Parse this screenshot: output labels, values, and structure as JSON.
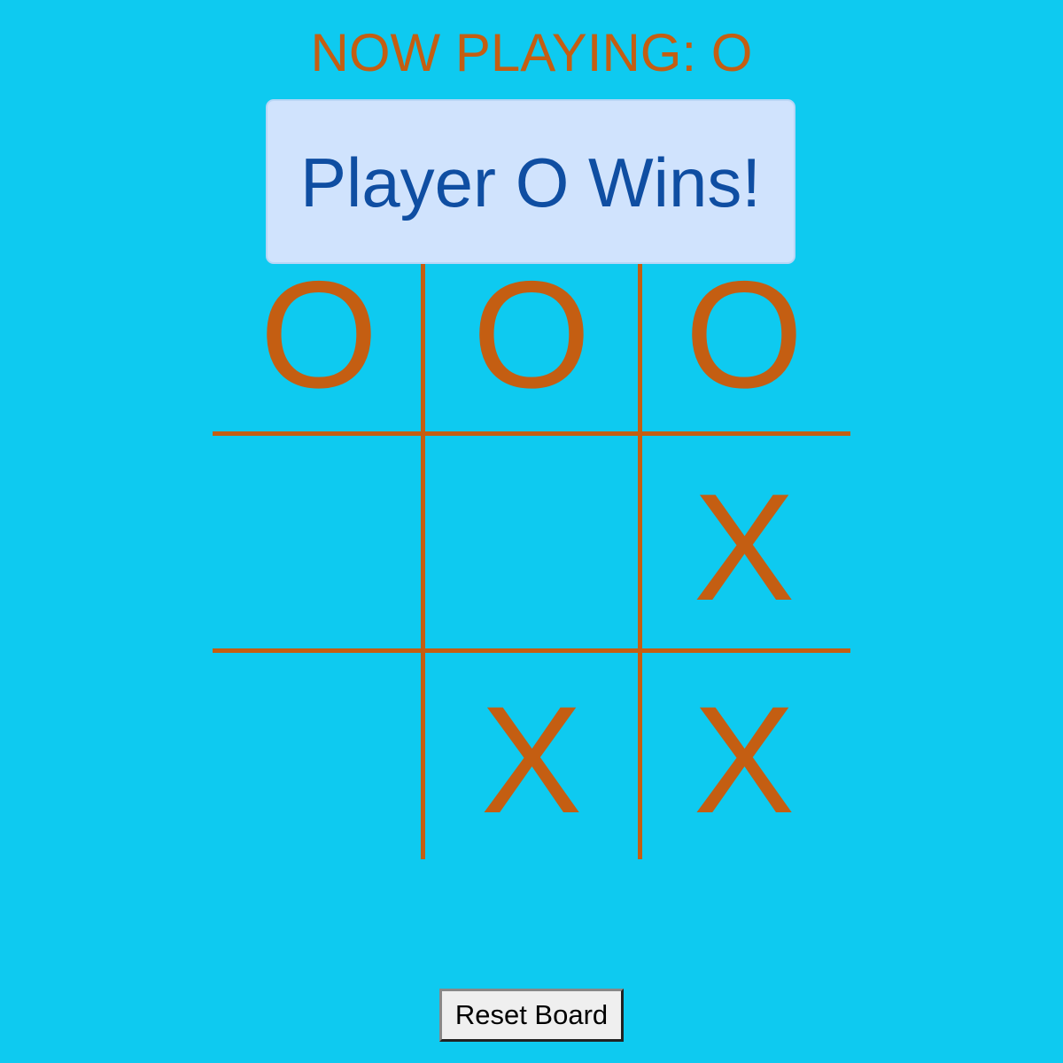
{
  "status": {
    "text": "NOW PLAYING: O"
  },
  "banner": {
    "text": "Player O Wins!"
  },
  "board": {
    "cells": [
      "O",
      "O",
      "O",
      "",
      "",
      "X",
      "",
      "X",
      "X"
    ]
  },
  "controls": {
    "reset_label": "Reset Board"
  },
  "colors": {
    "background": "#0ecaf0",
    "marks": "#c45e12",
    "banner_bg": "#d0e3fd",
    "banner_text": "#0f4ea2"
  }
}
